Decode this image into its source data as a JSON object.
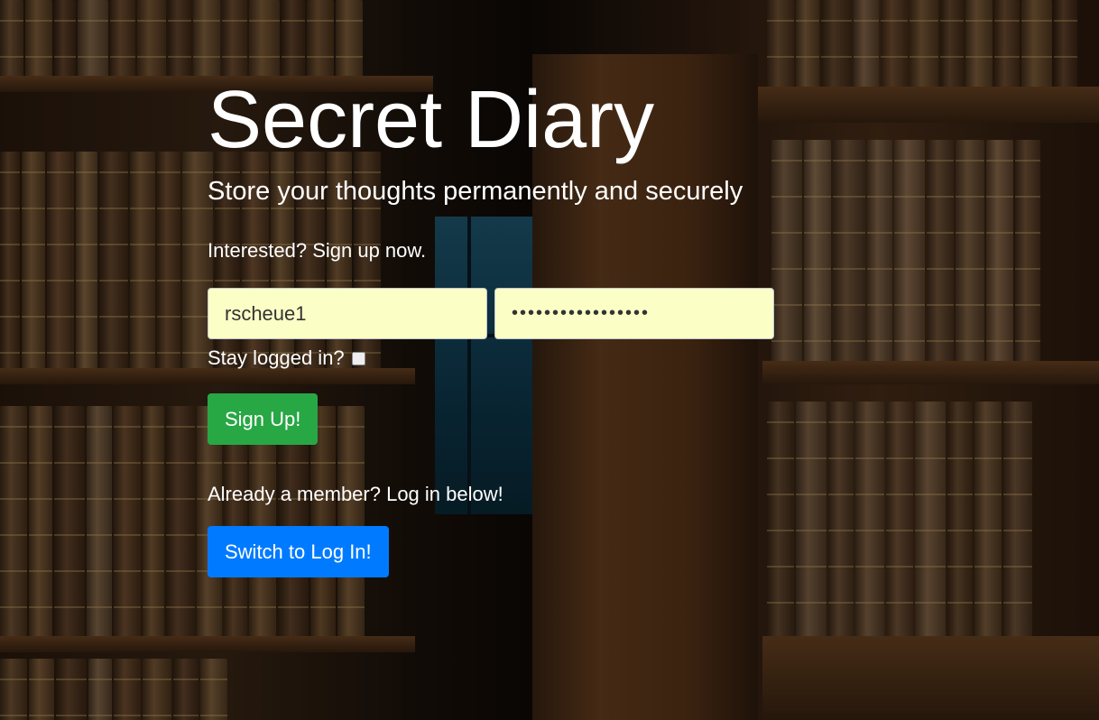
{
  "app": {
    "title": "Secret Diary",
    "subtitle": "Store your thoughts permanently and securely"
  },
  "signup": {
    "prompt": "Interested? Sign up now.",
    "email_value": "rscheue1",
    "password_value": "•••••••••••••••••",
    "stay_logged_label": "Stay logged in?",
    "stay_logged_checked": false,
    "submit_label": "Sign Up!"
  },
  "login_switch": {
    "prompt": "Already a member? Log in below!",
    "button_label": "Switch to Log In!"
  },
  "colors": {
    "input_bg": "#fbffc6",
    "signup_button": "#28a745",
    "switch_button": "#007bff"
  }
}
